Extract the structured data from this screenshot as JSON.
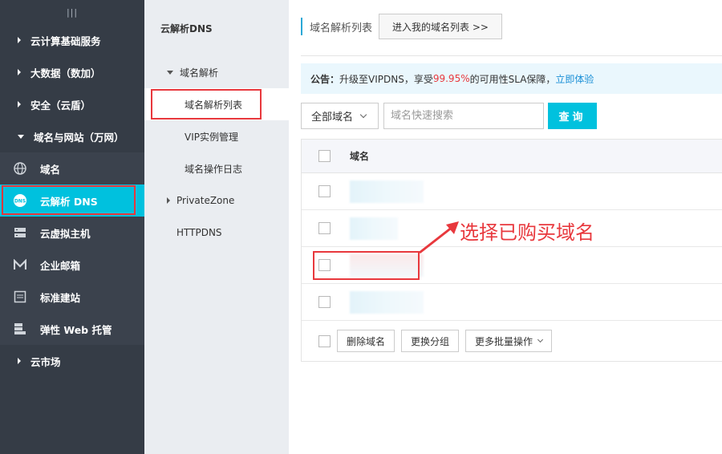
{
  "sidebar": {
    "collapse_label": "|||",
    "groups_top": [
      {
        "label": "云计算基础服务",
        "expanded": false
      },
      {
        "label": "大数据（数加）",
        "expanded": false
      },
      {
        "label": "安全（云盾）",
        "expanded": false
      },
      {
        "label": "域名与网站（万网）",
        "expanded": true
      }
    ],
    "items": [
      {
        "label": "域名",
        "icon": "globe-icon"
      },
      {
        "label": "云解析 DNS",
        "icon": "dns-icon",
        "active": true
      },
      {
        "label": "云虚拟主机",
        "icon": "server-icon"
      },
      {
        "label": "企业邮箱",
        "icon": "mail-icon"
      },
      {
        "label": "标准建站",
        "icon": "monitor-icon"
      },
      {
        "label": "弹性 Web 托管",
        "icon": "stack-icon"
      }
    ],
    "groups_bottom": [
      {
        "label": "云市场",
        "expanded": false
      }
    ]
  },
  "subnav": {
    "title": "云解析DNS",
    "group_label": "域名解析",
    "items": [
      "域名解析列表",
      "VIP实例管理",
      "域名操作日志"
    ],
    "private_zone": "PrivateZone",
    "httpdns": "HTTPDNS"
  },
  "header": {
    "page_title": "域名解析列表",
    "my_domains_button": "进入我的域名列表 >>"
  },
  "notice": {
    "prefix": "公告：",
    "text_before": "升级至VIPDNS，享受",
    "highlight": "99.95%",
    "text_after": "的可用性SLA保障，",
    "link": "立即体验"
  },
  "filters": {
    "scope": "全部域名",
    "search_placeholder": "域名快速搜索",
    "query_button": "查询"
  },
  "table": {
    "column_domain": "域名",
    "row_count": 4
  },
  "footer": {
    "delete_button": "删除域名",
    "regroup_button": "更换分组",
    "batch_button": "更多批量操作"
  },
  "annotation": {
    "text": "选择已购买域名"
  },
  "colors": {
    "accent": "#00c1de",
    "highlight_red": "#e8383d",
    "sidebar_bg": "#353c46",
    "subnav_bg": "#eaedf1"
  }
}
